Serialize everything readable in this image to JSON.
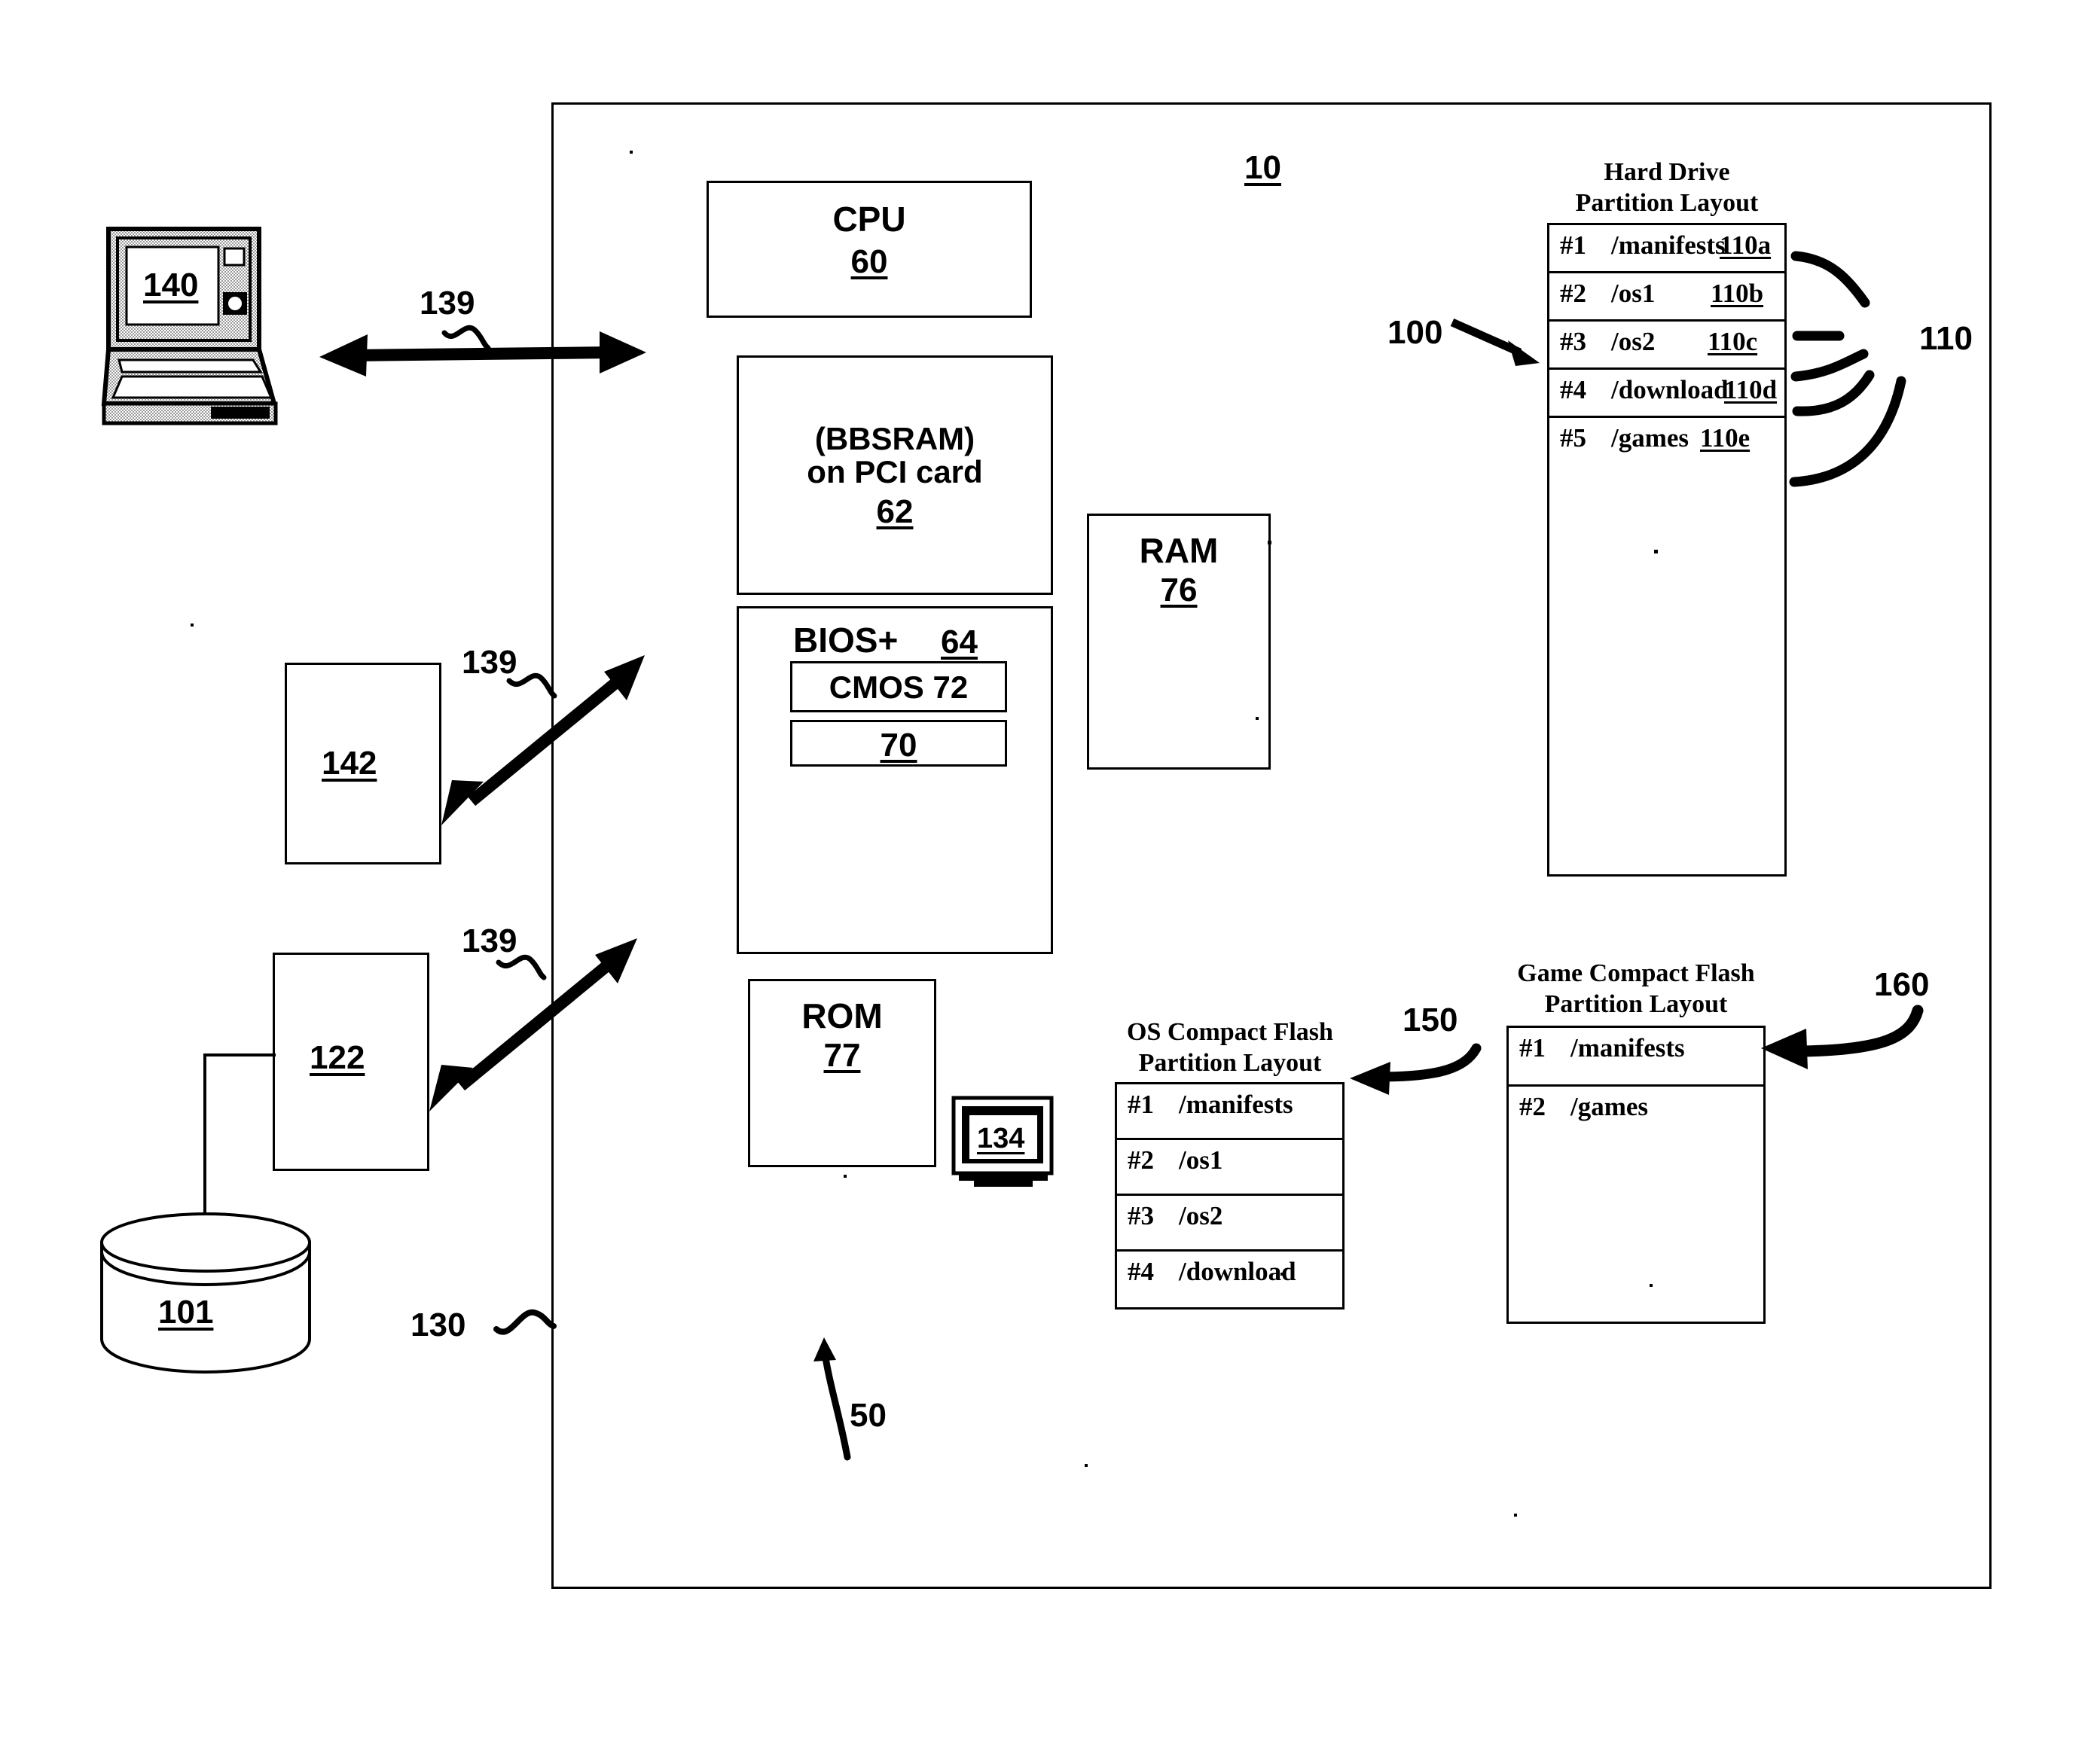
{
  "figure": {
    "system_ref": "10",
    "system_ref_bottom": "50",
    "bus_ref": "130",
    "hard_drive_ref_arrow": "100",
    "hard_drive_bracket_ref": "110",
    "os_cf_ref": "150",
    "game_cf_ref": "160"
  },
  "components": {
    "cpu": {
      "title": "CPU",
      "ref": "60"
    },
    "bbsram": {
      "line1": "(BBSRAM)",
      "line2": "on PCI card",
      "ref": "62"
    },
    "bios": {
      "title": "BIOS+",
      "ref": "64"
    },
    "cmos": {
      "label": "CMOS 72"
    },
    "bios_inner": {
      "ref": "70"
    },
    "ram": {
      "title": "RAM",
      "ref": "76"
    },
    "rom": {
      "title": "ROM",
      "ref": "77"
    },
    "monitor": {
      "ref": "134"
    }
  },
  "peripherals": {
    "laptop": {
      "ref": "140",
      "link_ref": "139"
    },
    "box_142": {
      "ref": "142",
      "link_ref": "139"
    },
    "box_122": {
      "ref": "122",
      "link_ref": "139"
    },
    "database_101": {
      "ref": "101"
    }
  },
  "hard_drive_table": {
    "title_line1": "Hard Drive",
    "title_line2": "Partition Layout",
    "rows": [
      {
        "num": "#1",
        "name": "/manifests",
        "ref": "110a"
      },
      {
        "num": "#2",
        "name": "/os1",
        "ref": "110b"
      },
      {
        "num": "#3",
        "name": "/os2",
        "ref": "110c"
      },
      {
        "num": "#4",
        "name": "/download",
        "ref": "110d"
      },
      {
        "num": "#5",
        "name": "/games",
        "ref": "110e"
      }
    ]
  },
  "os_cf_table": {
    "title_line1": "OS Compact Flash",
    "title_line2": "Partition Layout",
    "rows": [
      {
        "num": "#1",
        "name": "/manifests"
      },
      {
        "num": "#2",
        "name": "/os1"
      },
      {
        "num": "#3",
        "name": "/os2"
      },
      {
        "num": "#4",
        "name": "/download"
      }
    ]
  },
  "game_cf_table": {
    "title_line1": "Game Compact Flash",
    "title_line2": "Partition Layout",
    "rows": [
      {
        "num": "#1",
        "name": "/manifests"
      },
      {
        "num": "#2",
        "name": "/games"
      }
    ]
  }
}
